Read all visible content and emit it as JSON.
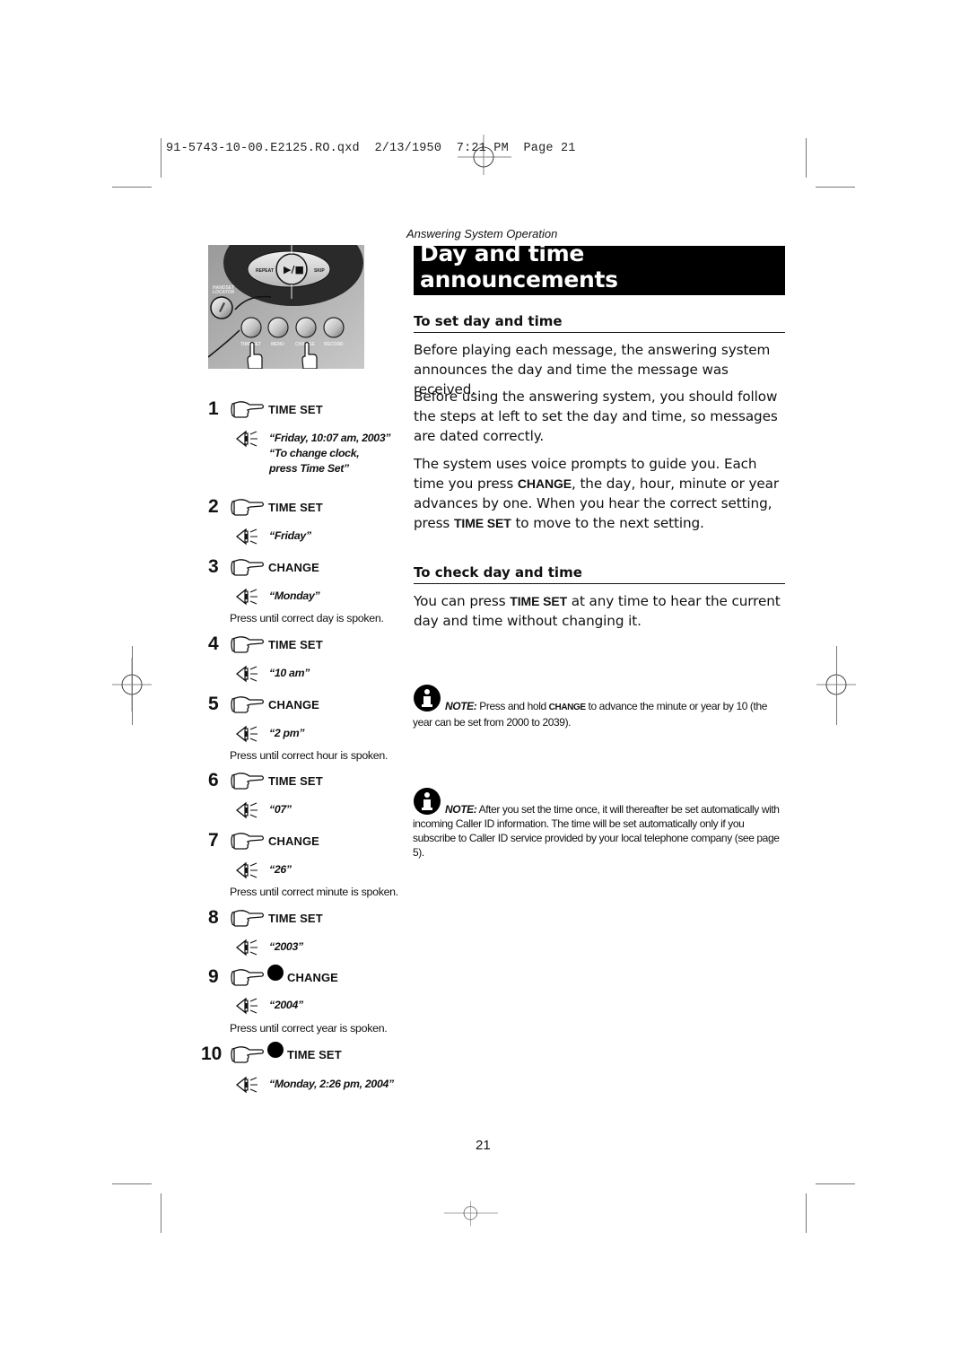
{
  "slug": {
    "filename": "91-5743-10-00.E2125.RO.qxd",
    "date": "2/13/1950",
    "time": "7:21 PM",
    "page_label": "Page 21"
  },
  "running_head": "Answering System Operation",
  "title": "Day and time announcements",
  "phone_panel": {
    "buttons": {
      "repeat": "REPEAT",
      "play_stop": "▶/■",
      "skip": "SKIP",
      "handset_locator": "HANDSET LOCATOR",
      "time_set": "TIME SET",
      "menu": "MENU",
      "change": "CHANGE",
      "record": "RECORD"
    }
  },
  "steps": [
    {
      "num": "1",
      "key": "TIME SET",
      "voice": [
        "“Friday, 10:07 am, 2003”",
        "“To change clock,",
        "press Time Set”"
      ],
      "hint": "",
      "dot": false
    },
    {
      "num": "2",
      "key": "TIME SET",
      "voice": [
        "“Friday”"
      ],
      "hint": "",
      "dot": false
    },
    {
      "num": "3",
      "key": "CHANGE",
      "voice": [
        "“Monday”"
      ],
      "hint": "Press until correct day is spoken.",
      "dot": false
    },
    {
      "num": "4",
      "key": "TIME SET",
      "voice": [
        "“10 am”"
      ],
      "hint": "",
      "dot": false
    },
    {
      "num": "5",
      "key": "CHANGE",
      "voice": [
        "“2 pm”"
      ],
      "hint": "Press until correct hour is spoken.",
      "dot": false
    },
    {
      "num": "6",
      "key": "TIME SET",
      "voice": [
        "“07”"
      ],
      "hint": "",
      "dot": false
    },
    {
      "num": "7",
      "key": "CHANGE",
      "voice": [
        "“26”"
      ],
      "hint": "Press until correct minute is spoken.",
      "dot": false
    },
    {
      "num": "8",
      "key": "TIME SET",
      "voice": [
        "“2003”"
      ],
      "hint": "",
      "dot": false
    },
    {
      "num": "9",
      "key": "CHANGE",
      "voice": [
        "“2004”"
      ],
      "hint": "Press until correct year is spoken.",
      "dot": true
    },
    {
      "num": "10",
      "key": "TIME SET",
      "voice": [
        "“Monday, 2:26 pm, 2004”"
      ],
      "hint": "",
      "dot": true
    }
  ],
  "set_section": {
    "heading": "To set day and time",
    "p1": "Before playing each message, the answering system announces the day and time the message was received.",
    "p2": "Before using the answering system, you should follow the steps at left to set the day and time, so messages are dated correctly.",
    "p3_a": "The system uses voice prompts to guide you. Each time you press ",
    "p3_key1": "CHANGE",
    "p3_b": ", the day, hour, minute or year advances by one. When you hear the correct setting, press ",
    "p3_key2": "TIME SET",
    "p3_c": " to move to the next setting."
  },
  "check_section": {
    "heading": "To check day and time",
    "p_a": "You can press ",
    "p_key": "TIME SET",
    "p_b": " at any time to hear the current day and time without changing it."
  },
  "notes": [
    {
      "label": "NOTE:",
      "a": " Press and hold ",
      "key": "CHANGE",
      "b": " to advance the minute or year by 10 (the year can be set from 2000 to 2039)."
    },
    {
      "label": "NOTE:",
      "a": " After you set the time once, it will thereafter be set automatically with incoming Caller ID information. The time will be set automatically only if you subscribe to Caller ID service provided by your local telephone company (see page 5).",
      "key": "",
      "b": ""
    }
  ],
  "page_number": "21"
}
